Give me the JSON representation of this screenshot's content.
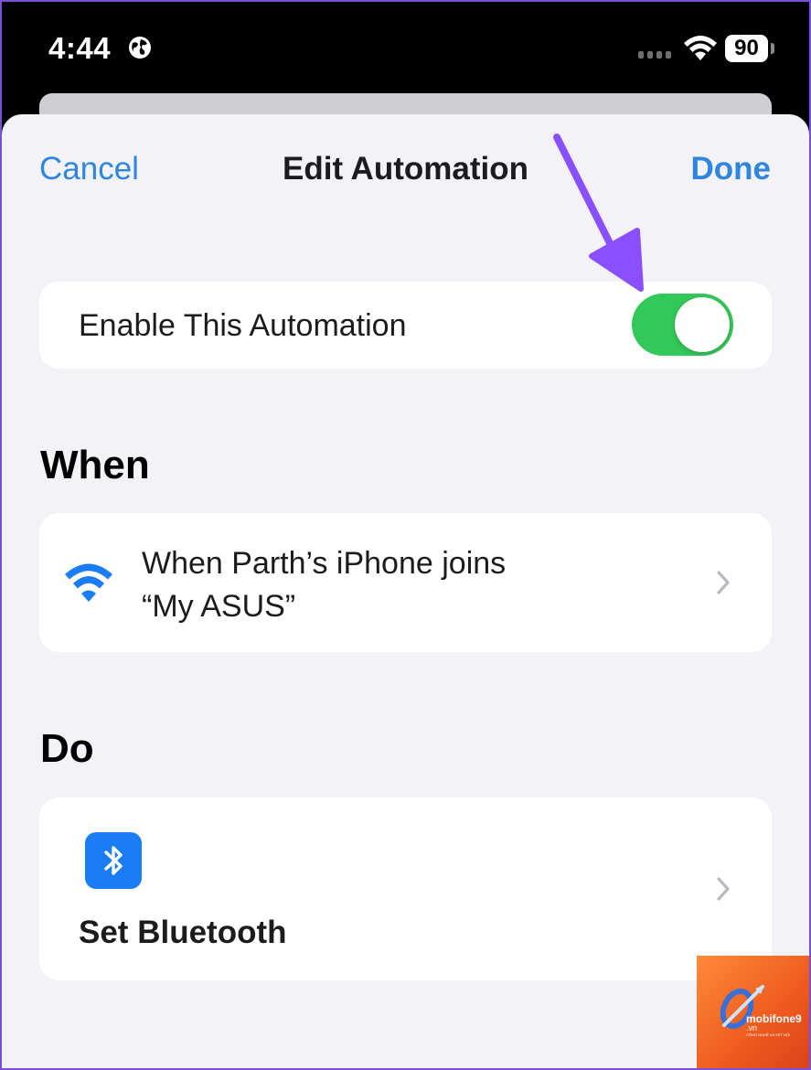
{
  "status_bar": {
    "time": "4:44",
    "battery": "90",
    "icons": [
      "globe-icon",
      "signal-dots-icon",
      "wifi-icon",
      "battery-icon"
    ]
  },
  "nav": {
    "cancel": "Cancel",
    "title": "Edit Automation",
    "done": "Done"
  },
  "toggle_row": {
    "label": "Enable This Automation",
    "enabled": true,
    "on_color": "#34c759"
  },
  "when": {
    "header": "When",
    "trigger_line1": "When Parth’s iPhone joins",
    "trigger_line2": "“My ASUS”",
    "icon": "wifi-icon"
  },
  "do": {
    "header": "Do",
    "action_label": "Set Bluetooth",
    "icon": "bluetooth-icon"
  },
  "annotation": {
    "icon": "arrow-pointer-icon",
    "color": "#8a4fff"
  },
  "watermark": {
    "brand": "mobifone9",
    "domain": ".vn",
    "tagline": "CÔNG NGHỆ VÀ KẾT NỐI"
  },
  "colors": {
    "accent": "#2f86de",
    "sheet_bg": "#f2f2f7",
    "bluetooth_bg": "#1a7df4"
  }
}
